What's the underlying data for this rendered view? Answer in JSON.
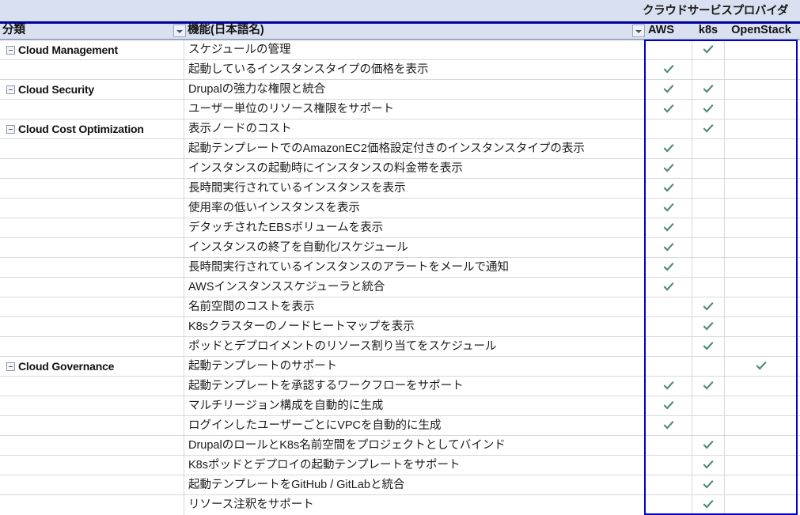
{
  "header": {
    "group_title": "クラウドサービスプロバイダ",
    "columns": {
      "category": "分類",
      "feature": "機能(日本語名)",
      "aws": "AWS",
      "k8s": "k8s",
      "openstack": "OpenStack"
    },
    "filter_icon": "filter-dropdown-icon"
  },
  "colors": {
    "band_bg": "#d9e0f0",
    "band_rule": "#00009e",
    "provider_box_border": "#0000cc",
    "check": "#4f8a78",
    "grid_line": "#d6d9de",
    "header_rule": "#9aa7bd"
  },
  "icons": {
    "collapse": "collapse-outline-icon",
    "check": "check-icon"
  },
  "rows": [
    {
      "category": "Cloud Management",
      "feature": "スケジュールの管理",
      "aws": false,
      "k8s": true,
      "openstack": false
    },
    {
      "category": "",
      "feature": "起動しているインスタンスタイプの価格を表示",
      "aws": true,
      "k8s": false,
      "openstack": false
    },
    {
      "category": "Cloud Security",
      "feature": "Drupalの強力な権限と統合",
      "aws": true,
      "k8s": true,
      "openstack": false
    },
    {
      "category": "",
      "feature": "ユーザー単位のリソース権限をサポート",
      "aws": true,
      "k8s": true,
      "openstack": false
    },
    {
      "category": "Cloud Cost Optimization",
      "feature": "表示ノードのコスト",
      "aws": false,
      "k8s": true,
      "openstack": false
    },
    {
      "category": "",
      "feature": "起動テンプレートでのAmazonEC2価格設定付きのインスタンスタイプの表示",
      "aws": true,
      "k8s": false,
      "openstack": false
    },
    {
      "category": "",
      "feature": "インスタンスの起動時にインスタンスの料金帯を表示",
      "aws": true,
      "k8s": false,
      "openstack": false
    },
    {
      "category": "",
      "feature": "長時間実行されているインスタンスを表示",
      "aws": true,
      "k8s": false,
      "openstack": false
    },
    {
      "category": "",
      "feature": "使用率の低いインスタンスを表示",
      "aws": true,
      "k8s": false,
      "openstack": false
    },
    {
      "category": "",
      "feature": "デタッチされたEBSボリュームを表示",
      "aws": true,
      "k8s": false,
      "openstack": false
    },
    {
      "category": "",
      "feature": "インスタンスの終了を自動化/スケジュール",
      "aws": true,
      "k8s": false,
      "openstack": false
    },
    {
      "category": "",
      "feature": "長時間実行されているインスタンスのアラートをメールで通知",
      "aws": true,
      "k8s": false,
      "openstack": false
    },
    {
      "category": "",
      "feature": "AWSインスタンススケジューラと統合",
      "aws": true,
      "k8s": false,
      "openstack": false
    },
    {
      "category": "",
      "feature": "名前空間のコストを表示",
      "aws": false,
      "k8s": true,
      "openstack": false
    },
    {
      "category": "",
      "feature": "K8sクラスターのノードヒートマップを表示",
      "aws": false,
      "k8s": true,
      "openstack": false
    },
    {
      "category": "",
      "feature": "ポッドとデプロイメントのリソース割り当てをスケジュール",
      "aws": false,
      "k8s": true,
      "openstack": false
    },
    {
      "category": "Cloud Governance",
      "feature": "起動テンプレートのサポート",
      "aws": false,
      "k8s": false,
      "openstack": true
    },
    {
      "category": "",
      "feature": "起動テンプレートを承認するワークフローをサポート",
      "aws": true,
      "k8s": true,
      "openstack": false
    },
    {
      "category": "",
      "feature": "マルチリージョン構成を自動的に生成",
      "aws": true,
      "k8s": false,
      "openstack": false
    },
    {
      "category": "",
      "feature": "ログインしたユーザーごとにVPCを自動的に生成",
      "aws": true,
      "k8s": false,
      "openstack": false
    },
    {
      "category": "",
      "feature": "DrupalのロールとK8s名前空間をプロジェクトとしてバインド",
      "aws": false,
      "k8s": true,
      "openstack": false
    },
    {
      "category": "",
      "feature": "K8sポッドとデプロイの起動テンプレートをサポート",
      "aws": false,
      "k8s": true,
      "openstack": false
    },
    {
      "category": "",
      "feature": "起動テンプレートをGitHub / GitLabと統合",
      "aws": false,
      "k8s": true,
      "openstack": false
    },
    {
      "category": "",
      "feature": "リソース注釈をサポート",
      "aws": false,
      "k8s": true,
      "openstack": false
    }
  ]
}
